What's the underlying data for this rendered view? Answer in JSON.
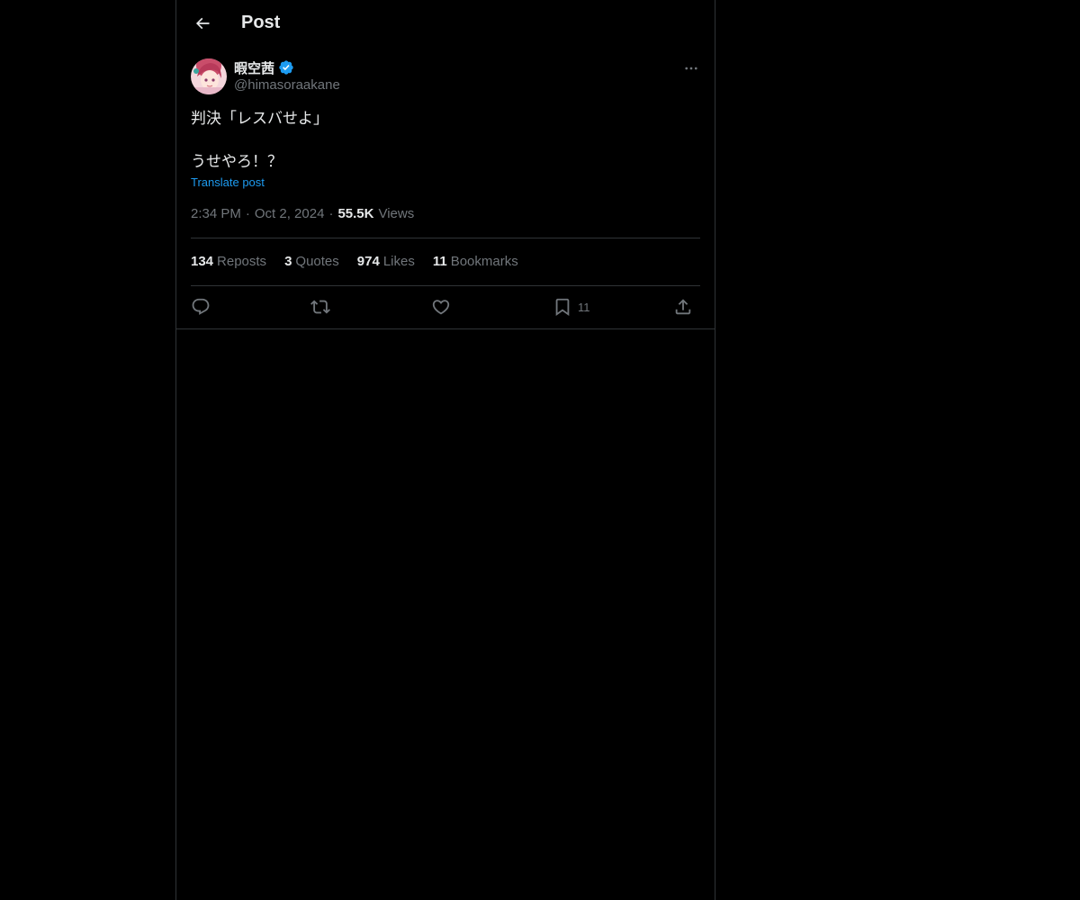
{
  "header": {
    "title": "Post"
  },
  "author": {
    "display_name": "暇空茜",
    "handle": "@himasoraakane",
    "verified": true
  },
  "post": {
    "lines": [
      "判決「レスバせよ」",
      "",
      "うせやろ！？"
    ],
    "translate_label": "Translate post",
    "time": "2:34 PM",
    "separator": "·",
    "date": "Oct 2, 2024",
    "views_count": "55.5K",
    "views_label": "Views"
  },
  "stats": [
    {
      "count": "134",
      "label": "Reposts"
    },
    {
      "count": "3",
      "label": "Quotes"
    },
    {
      "count": "974",
      "label": "Likes"
    },
    {
      "count": "11",
      "label": "Bookmarks"
    }
  ],
  "actions": {
    "bookmark_count": "11"
  },
  "colors": {
    "background": "#000000",
    "text": "#e7e9ea",
    "muted": "#71767b",
    "accent": "#1d9bf0",
    "border": "#2f3336"
  }
}
